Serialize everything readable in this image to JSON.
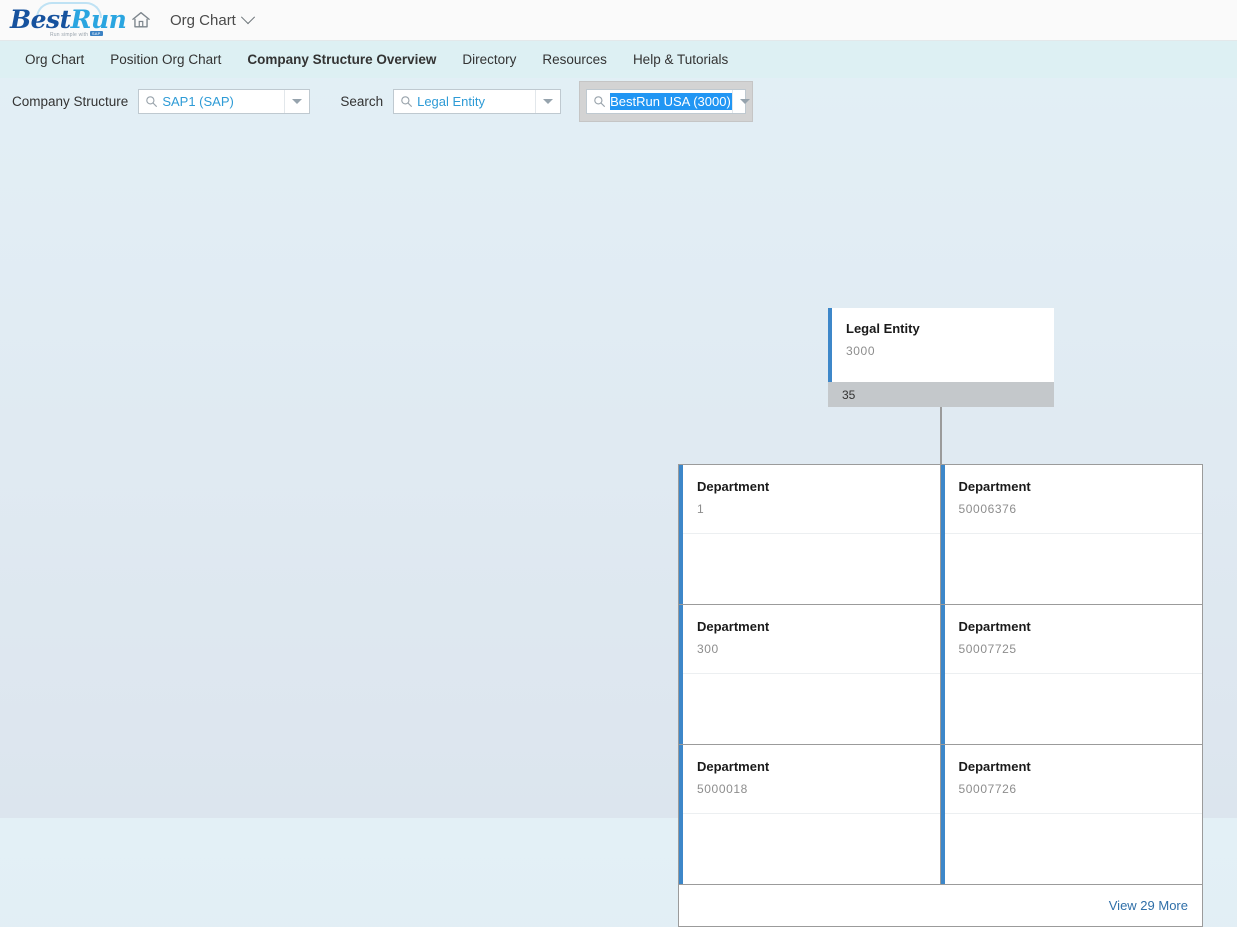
{
  "topbar": {
    "logo": {
      "part1": "Best",
      "part2": "Run",
      "tagline_prefix": "Run simple with ",
      "tagline_mark": "SAP"
    },
    "home_icon": "home-icon",
    "breadcrumb_label": "Org Chart",
    "breadcrumb_chevron": "chevron-down-icon"
  },
  "nav": {
    "items": [
      {
        "label": "Org Chart",
        "active": false
      },
      {
        "label": "Position Org Chart",
        "active": false
      },
      {
        "label": "Company Structure Overview",
        "active": true
      },
      {
        "label": "Directory",
        "active": false
      },
      {
        "label": "Resources",
        "active": false
      },
      {
        "label": "Help & Tutorials",
        "active": false
      }
    ]
  },
  "filters": {
    "company_structure_label": "Company Structure",
    "company_structure_value": "SAP1 (SAP)",
    "company_structure_placeholder": "SAP1 (SAP)",
    "search_label": "Search",
    "search_type_value": "Legal Entity",
    "search_type_placeholder": "Legal Entity",
    "search_entity_value": "BestRun USA (3000)",
    "search_entity_placeholder": "BestRun USA (3000)",
    "search_icon": "search-icon",
    "dropdown_icon": "caret-down-icon"
  },
  "chart": {
    "root": {
      "title": "Legal Entity",
      "id": "3000",
      "footer_count": "35"
    },
    "children": [
      {
        "title": "Department",
        "id": "1"
      },
      {
        "title": "Department",
        "id": "50006376"
      },
      {
        "title": "Department",
        "id": "300"
      },
      {
        "title": "Department",
        "id": "50007725"
      },
      {
        "title": "Department",
        "id": "5000018"
      },
      {
        "title": "Department",
        "id": "50007726"
      }
    ],
    "more_link": "View 29 More"
  },
  "colors": {
    "accent_blue": "#3d87c9",
    "link_blue": "#2f6fa8",
    "combo_text_blue": "#2e9bd6",
    "selection_blue": "#2196f3",
    "node_footer_gray": "#c4c8cb",
    "nav_bg": "#ddf0f3"
  }
}
